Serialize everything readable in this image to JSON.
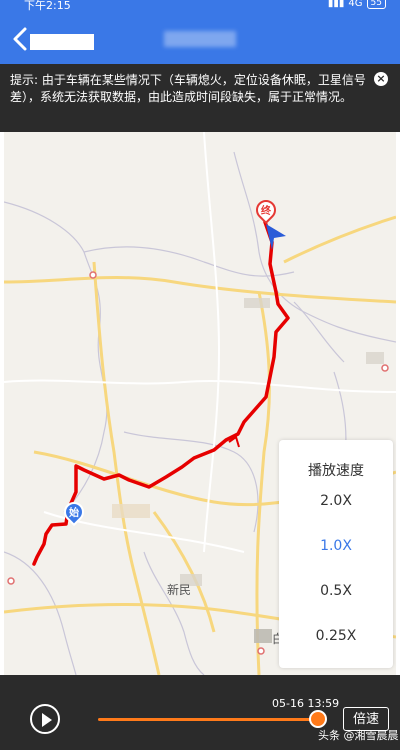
{
  "status_bar": {
    "time": "下午2:15",
    "signal": "4G",
    "battery": "55"
  },
  "notice": {
    "text": "提示: 由于车辆在某些情况下（车辆熄火，定位设备休眠，卫星信号差），系统无法获取数据，由此造成时间段缺失，属于正常情况。",
    "close_icon": "×"
  },
  "map": {
    "labels": {
      "place_lower": "新民",
      "place_right": "白"
    },
    "markers": {
      "end": "终",
      "start": "始"
    },
    "route_color": "#e60000"
  },
  "speed_panel": {
    "title": "播放速度",
    "options": [
      {
        "label": "2.0X",
        "selected": false
      },
      {
        "label": "1.0X",
        "selected": true
      },
      {
        "label": "0.5X",
        "selected": false
      },
      {
        "label": "0.25X",
        "selected": false
      }
    ]
  },
  "playback": {
    "timestamp": "05-16 13:59",
    "speed_button": "倍速",
    "progress": 0.95,
    "accent": "#ff7a1a"
  },
  "watermark": "头条 @湘雪晨晨"
}
